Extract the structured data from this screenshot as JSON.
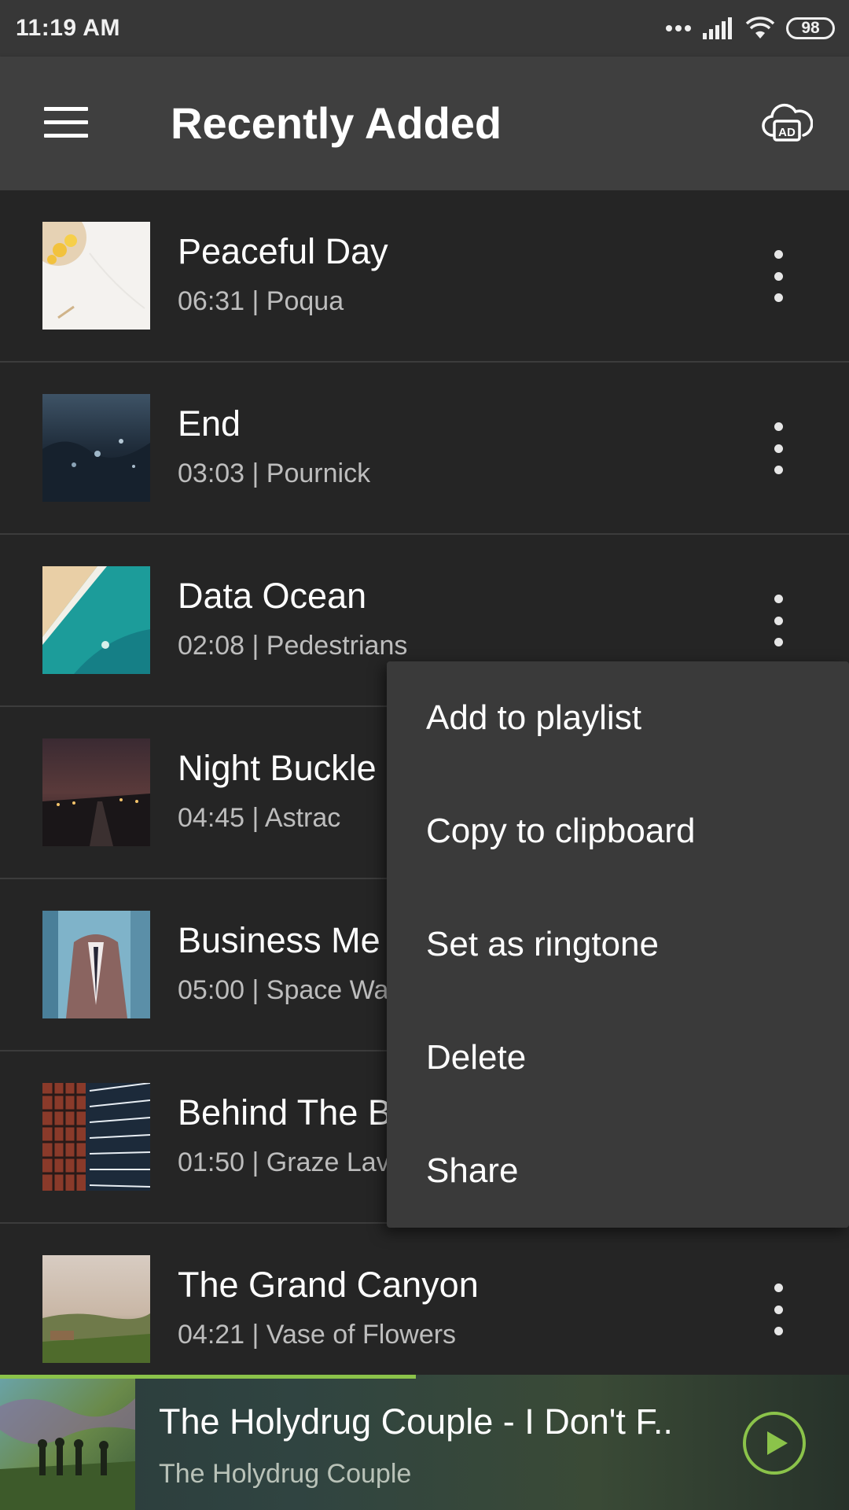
{
  "status_bar": {
    "time": "11:19 AM",
    "battery": "98"
  },
  "app_bar": {
    "title": "Recently Added"
  },
  "songs": [
    {
      "title": "Peaceful Day",
      "meta": "06:31 | Poqua"
    },
    {
      "title": "End",
      "meta": "03:03 | Pournick"
    },
    {
      "title": "Data Ocean",
      "meta": "02:08 | Pedestrians"
    },
    {
      "title": "Night Buckle",
      "meta": "04:45 | Astrac"
    },
    {
      "title": "Business Me",
      "meta": "05:00 | Space Wa"
    },
    {
      "title": "Behind The B",
      "meta": "01:50 | Graze Lav"
    },
    {
      "title": "The Grand Canyon",
      "meta": "04:21 | Vase of Flowers"
    }
  ],
  "context_menu": {
    "items": [
      "Add to playlist",
      "Copy to clipboard",
      "Set as ringtone",
      "Delete",
      "Share"
    ]
  },
  "player": {
    "title": "The Holydrug Couple - I Don't F..",
    "artist": "The Holydrug Couple",
    "progress": 0.49
  },
  "colors": {
    "accent": "#8bc34a",
    "app_bar": "#3f3f3f",
    "status_bar": "#373737",
    "background": "#252525",
    "menu": "#3a3a3a"
  },
  "icons": {
    "menu": "hamburger-menu-icon",
    "ad": "cloud-ad-icon",
    "more": "more-vert-icon",
    "play": "play-circle-icon",
    "signal": "signal-icon",
    "wifi": "wifi-icon"
  }
}
